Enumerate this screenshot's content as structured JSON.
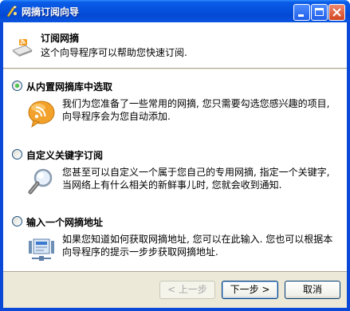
{
  "window": {
    "title": "网摘订阅向导",
    "icon": "wizard-app-icon"
  },
  "header": {
    "title": "订阅网摘",
    "subtitle": "这个向导程序可以帮助您快速订阅.",
    "icon": "rss-feed-icon"
  },
  "options": [
    {
      "label": "从内置网摘库中选取",
      "description": "我们为您准备了一些常用的网摘, 您只需要勾选您感兴趣的项目, 向导程序会为您自动添加.",
      "icon": "rss-bubble-icon",
      "checked": true
    },
    {
      "label": "自定义关键字订阅",
      "description": "您甚至可以自定义一个属于您自己的专用网摘, 指定一个关键字, 当网络上有什么相关的新鲜事儿时, 您就会收到通知.",
      "icon": "magnifier-icon",
      "checked": false
    },
    {
      "label": "输入一个网摘地址",
      "description": "如果您知道如何获取网摘地址, 您可以在此输入. 您也可以根据本向导程序的提示一步步获取网摘地址.",
      "icon": "network-address-icon",
      "checked": false
    }
  ],
  "buttons": {
    "back": "< 上一步",
    "next": "下一步 >",
    "cancel": "取消"
  },
  "colors": {
    "titlebar": "#0551de",
    "accent_orange": "#f39a1c",
    "face": "#ece9d8"
  }
}
